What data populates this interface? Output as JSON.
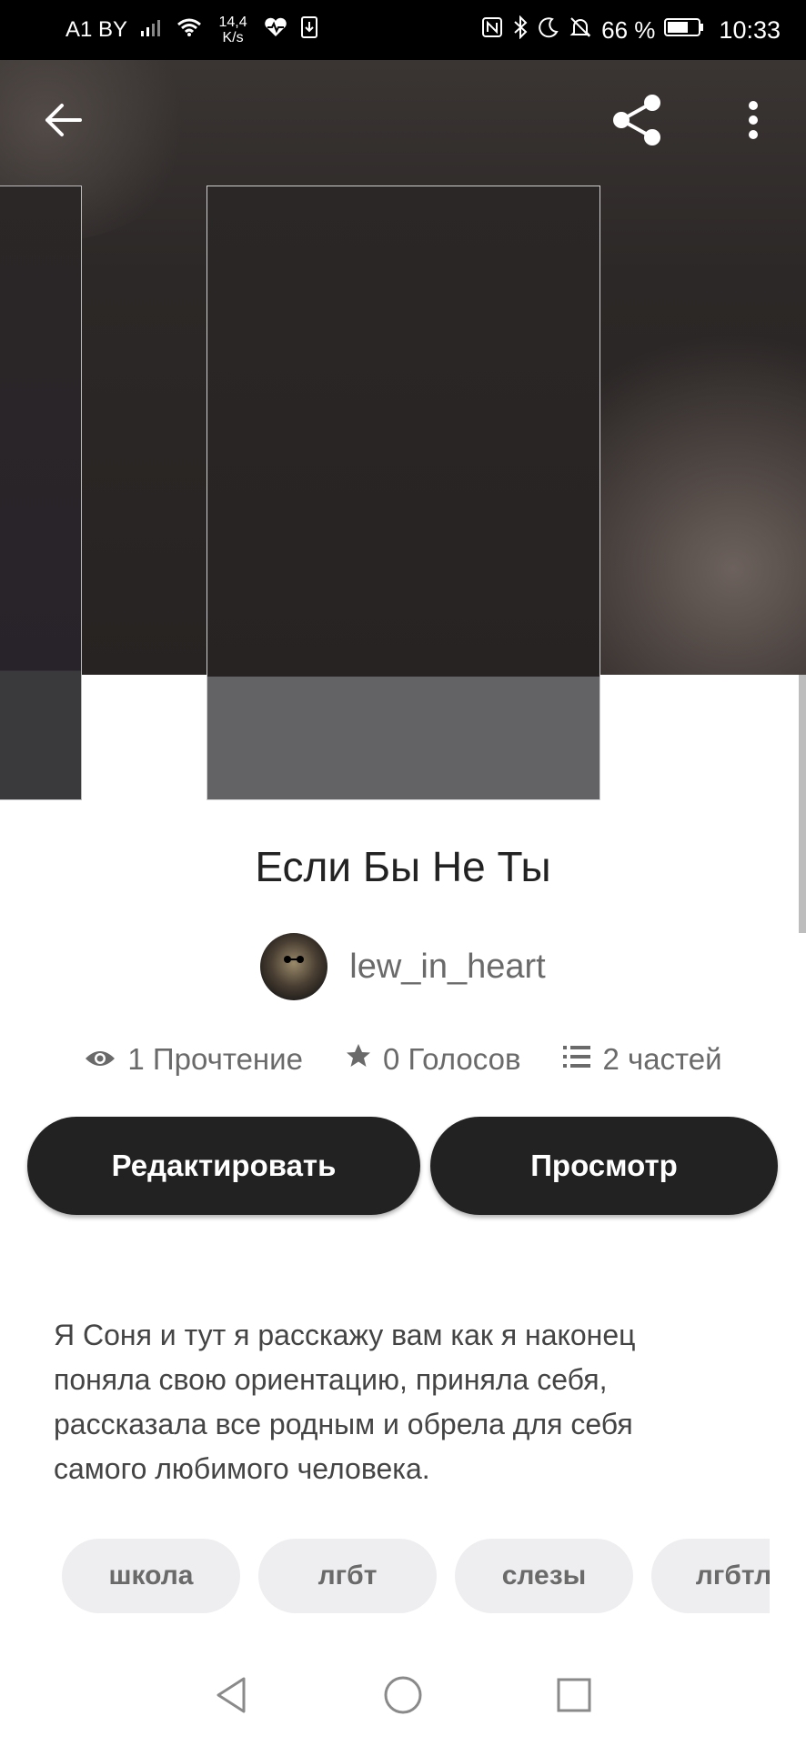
{
  "status_bar": {
    "carrier": "A1 BY",
    "net_speed_value": "14,4",
    "net_speed_unit": "K/s",
    "battery_percent": "66 %",
    "time": "10:33",
    "icons": [
      "signal-icon",
      "wifi-icon",
      "heart-rate-icon",
      "download-icon",
      "nfc-icon",
      "bluetooth-icon",
      "moon-icon",
      "bell-off-icon",
      "battery-icon"
    ]
  },
  "toolbar": {
    "icons": [
      "back-arrow-icon",
      "share-icon",
      "more-vert-icon"
    ]
  },
  "story": {
    "title": "Если Бы Не Ты",
    "author": "lew_in_heart",
    "stats": {
      "reads": "1 Прочтение",
      "votes": "0 Голосов",
      "parts": "2 частей"
    },
    "edit_label": "Редактировать",
    "view_label": "Просмотр",
    "description": "Я Соня и тут я расскажу вам как я наконец поняла свою ориентацию, приняла себя, рассказала все родным и обрела для себя самого любимого человека.",
    "tags": [
      "школа",
      "лгбт",
      "слезы",
      "лгбтлк"
    ]
  },
  "nav_bar": {
    "icons": [
      "nav-back-icon",
      "nav-home-icon",
      "nav-recent-icon"
    ]
  }
}
